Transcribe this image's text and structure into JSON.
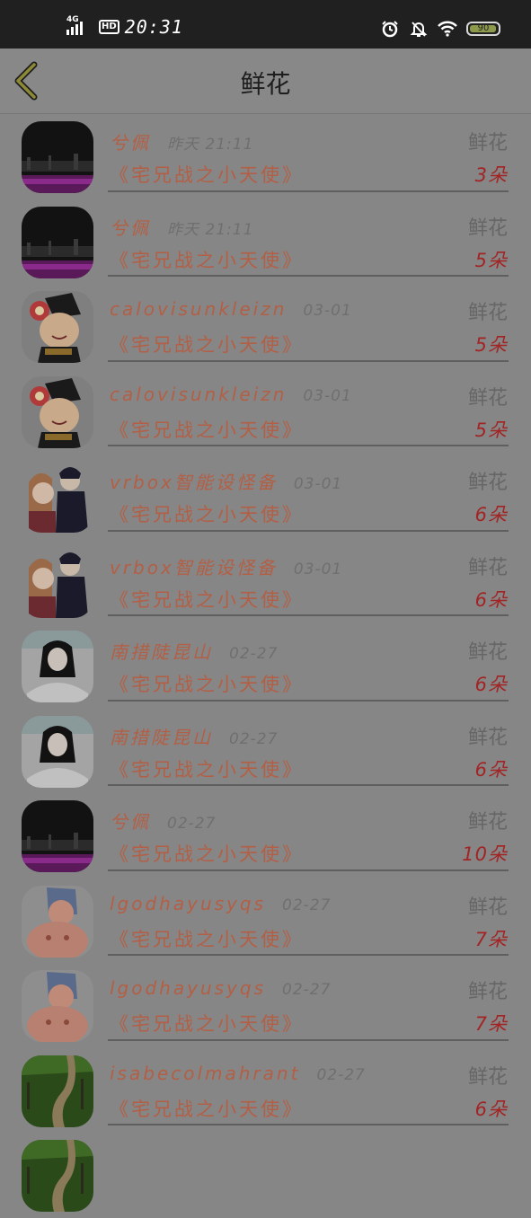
{
  "status_bar": {
    "network": "4G",
    "hd": "HD",
    "time": "20:31",
    "battery": "90"
  },
  "header": {
    "title": "鲜花"
  },
  "items": [
    {
      "name": "兮佩",
      "time": "昨天 21:11",
      "category": "鲜花",
      "book": "《宅兄战之小天使》",
      "count": "3朵",
      "avatar": "night-city-avatar"
    },
    {
      "name": "兮佩",
      "time": "昨天 21:11",
      "category": "鲜花",
      "book": "《宅兄战之小天使》",
      "count": "5朵",
      "avatar": "night-city-avatar"
    },
    {
      "name": "calovisunkleizn",
      "time": "03-01",
      "category": "鲜花",
      "book": "《宅兄战之小天使》",
      "count": "5朵",
      "avatar": "cartoon-lady-avatar"
    },
    {
      "name": "calovisunkleizn",
      "time": "03-01",
      "category": "鲜花",
      "book": "《宅兄战之小天使》",
      "count": "5朵",
      "avatar": "cartoon-lady-avatar"
    },
    {
      "name": "vrbox智能设怪备",
      "time": "03-01",
      "category": "鲜花",
      "book": "《宅兄战之小天使》",
      "count": "6朵",
      "avatar": "anime-couple-avatar"
    },
    {
      "name": "vrbox智能设怪备",
      "time": "03-01",
      "category": "鲜花",
      "book": "《宅兄战之小天使》",
      "count": "6朵",
      "avatar": "anime-couple-avatar"
    },
    {
      "name": "南措陡昆山",
      "time": "02-27",
      "category": "鲜花",
      "book": "《宅兄战之小天使》",
      "count": "6朵",
      "avatar": "girl-photo-avatar"
    },
    {
      "name": "南措陡昆山",
      "time": "02-27",
      "category": "鲜花",
      "book": "《宅兄战之小天使》",
      "count": "6朵",
      "avatar": "girl-photo-avatar"
    },
    {
      "name": "兮佩",
      "time": "02-27",
      "category": "鲜花",
      "book": "《宅兄战之小天使》",
      "count": "10朵",
      "avatar": "night-city-avatar"
    },
    {
      "name": "lgodhayusyqs",
      "time": "02-27",
      "category": "鲜花",
      "book": "《宅兄战之小天使》",
      "count": "7朵",
      "avatar": "masked-man-avatar"
    },
    {
      "name": "lgodhayusyqs",
      "time": "02-27",
      "category": "鲜花",
      "book": "《宅兄战之小天使》",
      "count": "7朵",
      "avatar": "masked-man-avatar"
    },
    {
      "name": "isabecolmahrant",
      "time": "02-27",
      "category": "鲜花",
      "book": "《宅兄战之小天使》",
      "count": "6朵",
      "avatar": "green-field-avatar"
    },
    {
      "name": "",
      "time": "",
      "category": "",
      "book": "",
      "count": "",
      "avatar": "green-field-avatar"
    }
  ]
}
